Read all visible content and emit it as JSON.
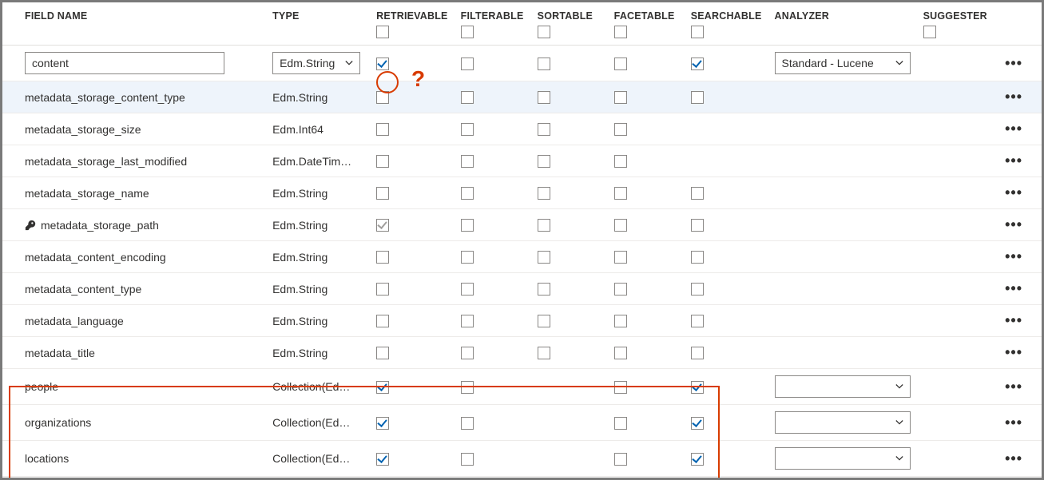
{
  "headers": {
    "fieldName": "FIELD NAME",
    "type": "TYPE",
    "retrievable": "RETRIEVABLE",
    "filterable": "FILTERABLE",
    "sortable": "SORTABLE",
    "facetable": "FACETABLE",
    "searchable": "SEARCHABLE",
    "analyzer": "ANALYZER",
    "suggester": "SUGGESTER"
  },
  "analyzerDefault": "Standard - Lucene",
  "rows": [
    {
      "name": "content",
      "type": "Edm.String",
      "editable": true,
      "analyzer": "Standard - Lucene",
      "chk": {
        "retrievable": true,
        "filterable": false,
        "sortable": false,
        "facetable": false,
        "searchable": true
      }
    },
    {
      "name": "metadata_storage_content_type",
      "type": "Edm.String",
      "highlight": true,
      "chk": {
        "retrievable": false,
        "filterable": false,
        "sortable": false,
        "facetable": false,
        "searchable": false
      }
    },
    {
      "name": "metadata_storage_size",
      "type": "Edm.Int64",
      "chk": {
        "retrievable": false,
        "filterable": false,
        "sortable": false,
        "facetable": false
      }
    },
    {
      "name": "metadata_storage_last_modified",
      "type": "Edm.DateTim…",
      "chk": {
        "retrievable": false,
        "filterable": false,
        "sortable": false,
        "facetable": false
      }
    },
    {
      "name": "metadata_storage_name",
      "type": "Edm.String",
      "chk": {
        "retrievable": false,
        "filterable": false,
        "sortable": false,
        "facetable": false,
        "searchable": false
      }
    },
    {
      "name": "metadata_storage_path",
      "type": "Edm.String",
      "key": true,
      "chk": {
        "retrievable": "gray",
        "filterable": false,
        "sortable": false,
        "facetable": false,
        "searchable": false
      }
    },
    {
      "name": "metadata_content_encoding",
      "type": "Edm.String",
      "chk": {
        "retrievable": false,
        "filterable": false,
        "sortable": false,
        "facetable": false,
        "searchable": false
      }
    },
    {
      "name": "metadata_content_type",
      "type": "Edm.String",
      "chk": {
        "retrievable": false,
        "filterable": false,
        "sortable": false,
        "facetable": false,
        "searchable": false
      }
    },
    {
      "name": "metadata_language",
      "type": "Edm.String",
      "chk": {
        "retrievable": false,
        "filterable": false,
        "sortable": false,
        "facetable": false,
        "searchable": false
      }
    },
    {
      "name": "metadata_title",
      "type": "Edm.String",
      "chk": {
        "retrievable": false,
        "filterable": false,
        "sortable": false,
        "facetable": false,
        "searchable": false
      }
    },
    {
      "name": "people",
      "type": "Collection(Ed…",
      "analyzer": "",
      "chk": {
        "retrievable": true,
        "filterable": false,
        "facetable": false,
        "searchable": true
      }
    },
    {
      "name": "organizations",
      "type": "Collection(Ed…",
      "analyzer": "",
      "chk": {
        "retrievable": true,
        "filterable": false,
        "facetable": false,
        "searchable": true
      }
    },
    {
      "name": "locations",
      "type": "Collection(Ed…",
      "analyzer": "",
      "chk": {
        "retrievable": true,
        "filterable": false,
        "facetable": false,
        "searchable": true
      }
    }
  ],
  "annotations": {
    "questionMark": "?"
  }
}
